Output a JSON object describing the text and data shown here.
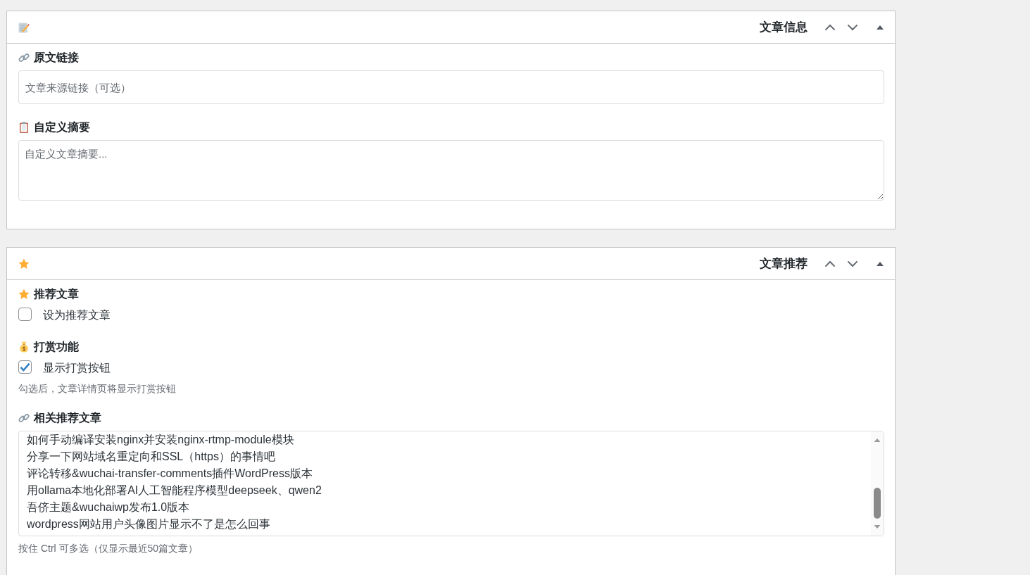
{
  "panels": [
    {
      "title": "文章信息",
      "expanded": true,
      "fields": [
        {
          "kind": "text",
          "label": "原文链接",
          "placeholder": "文章来源链接（可选）"
        },
        {
          "kind": "textarea",
          "label": "自定义摘要",
          "placeholder": "自定义文章摘要..."
        }
      ]
    },
    {
      "title": "文章推荐",
      "expanded": true,
      "fields": [
        {
          "kind": "checkbox",
          "label": "推荐文章",
          "option": "设为推荐文章",
          "checked": false
        },
        {
          "kind": "checkbox",
          "label": "打赏功能",
          "option": "显示打赏按钮",
          "checked": true,
          "help": "勾选后，文章详情页将显示打赏按钮"
        },
        {
          "kind": "listbox",
          "label": "相关推荐文章",
          "options": [
            {
              "text": "如何手动编译安装nginx并安装nginx-rtmp-module模块",
              "selected": false
            },
            {
              "text": "分享一下网站域名重定向和SSL（https）的事情吧",
              "selected": false
            },
            {
              "text": "评论转移&wuchai-transfer-comments插件WordPress版本",
              "selected": false
            },
            {
              "text": "用ollama本地化部署AI人工智能程序模型deepseek、qwen2",
              "selected": false
            },
            {
              "text": "吾侪主题&wuchaiwp发布1.0版本",
              "selected": false
            },
            {
              "text": "wordpress网站用户头像图片显示不了是怎么回事",
              "selected": false
            }
          ],
          "help": "按住 Ctrl 可多选（仅显示最近50篇文章）"
        }
      ]
    }
  ]
}
